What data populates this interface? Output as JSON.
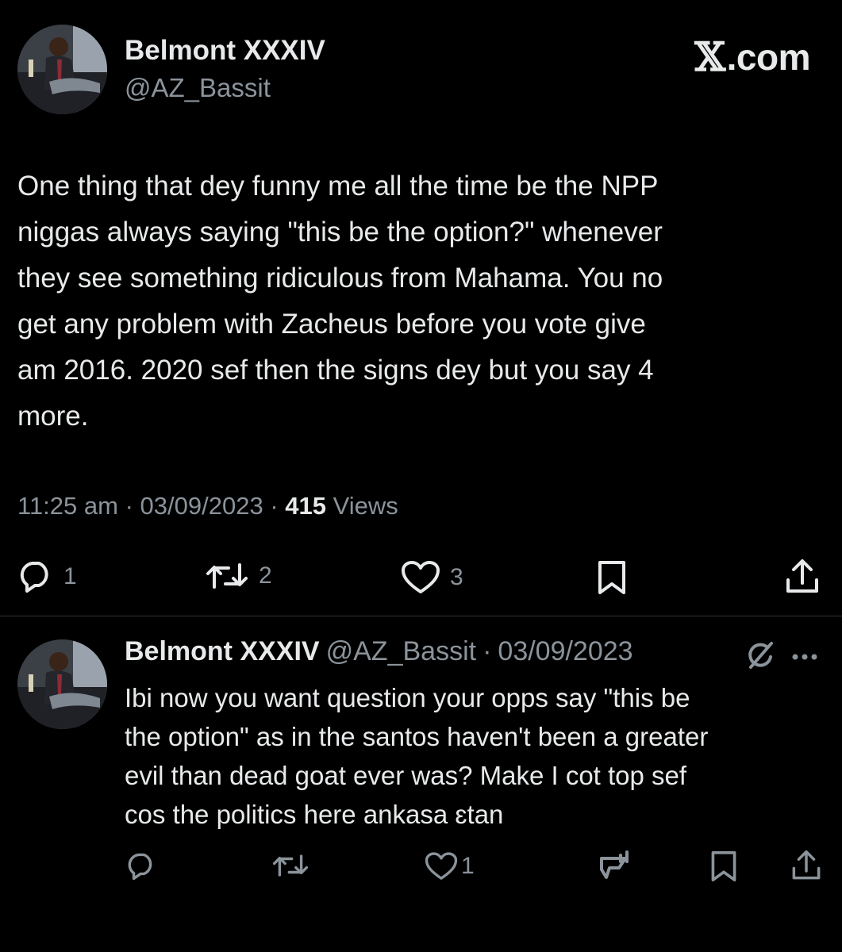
{
  "brand": {
    "label": "X.com",
    "mark": "𝕏",
    "suffix": ".com"
  },
  "main_tweet": {
    "author_name": "Belmont XXXIV",
    "author_handle": "@AZ_Bassit",
    "text": "One thing that dey funny me all the time be the NPP\nniggas always saying \"this be the option?\" whenever\nthey see something ridiculous from Mahama. You no\nget any problem with Zacheus before you vote give\nam 2016. 2020 sef then the signs dey but you say 4\nmore.",
    "time": "11:25 am",
    "date": "03/09/2023",
    "views_count": "415",
    "views_label": "Views",
    "separator": "·",
    "actions": {
      "replies": "1",
      "reposts": "2",
      "likes": "3"
    }
  },
  "reply_tweet": {
    "author_name": "Belmont XXXIV",
    "author_handle": "@AZ_Bassit",
    "separator": "·",
    "date": "03/09/2023",
    "text": "Ibi now you want question your opps say \"this be\nthe option\" as in the santos haven't been a greater\nevil than dead goat ever was? Make I cot top sef\ncos the politics here ankasa ɛtan",
    "actions": {
      "replies": "",
      "reposts": "",
      "likes": "1"
    }
  },
  "colors": {
    "background": "#000000",
    "text_primary": "#e7e9ea",
    "text_secondary": "#8b939b",
    "divider": "#2f3336"
  },
  "icons": {
    "reply": "reply-bubble-icon",
    "repost": "repost-arrows-icon",
    "like": "heart-icon",
    "bookmark": "bookmark-icon",
    "share": "share-upload-icon",
    "grok": "grok-slash-icon",
    "more": "more-dots-icon",
    "analytics": "bar-chart-icon"
  }
}
